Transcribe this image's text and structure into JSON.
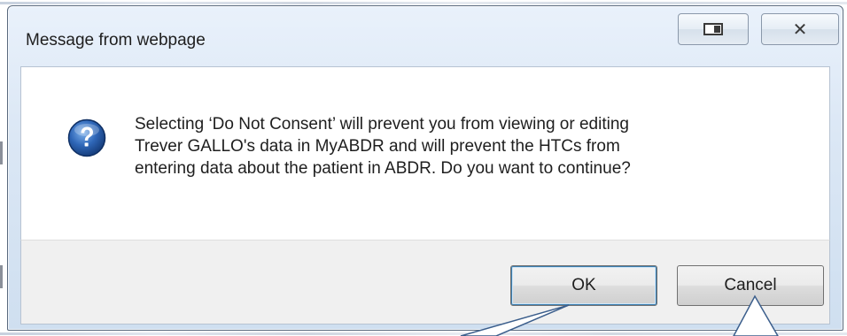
{
  "dialog": {
    "title": "Message from webpage",
    "icon": "question-icon",
    "message_lines": [
      "Selecting ‘Do Not Consent’ will prevent you from viewing or editing",
      "Trever GALLO's data in MyABDR and will prevent the HTCs from",
      "entering data about the patient in ABDR. Do you want to continue?"
    ],
    "buttons": {
      "ok_label": "OK",
      "cancel_label": "Cancel"
    },
    "caption_buttons": {
      "compat_icon": "compatibility-view-icon",
      "close_glyph": "✕"
    }
  },
  "colors": {
    "frame": "#dbe7f5",
    "content_bg": "#ffffff",
    "footer_bg": "#f0f0f0",
    "question_icon": "#2a5ca8",
    "callout_stroke": "#3b5e8c"
  }
}
